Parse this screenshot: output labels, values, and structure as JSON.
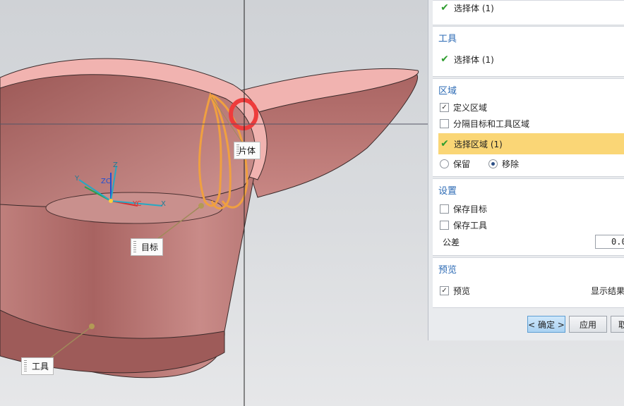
{
  "viewport": {
    "labels": {
      "sheet_body": "片体",
      "target": "目标",
      "tool": "工具"
    },
    "csys_axes": [
      "ZC",
      "YC",
      "X",
      "Y",
      "Z"
    ]
  },
  "panel": {
    "top_group": {
      "item": "选择体 (1)"
    },
    "tool_group": {
      "title": "工具",
      "item": "选择体 (1)"
    },
    "region_group": {
      "title": "区域",
      "define_region": {
        "label": "定义区域",
        "checked": true
      },
      "separate": {
        "label": "分隔目标和工具区域",
        "checked": false
      },
      "select_region": "选择区域 (1)",
      "keep": {
        "label": "保留",
        "selected": false
      },
      "remove": {
        "label": "移除",
        "selected": true
      }
    },
    "settings_group": {
      "title": "设置",
      "keep_target": {
        "label": "保存目标",
        "checked": false
      },
      "keep_tool": {
        "label": "保存工具",
        "checked": false
      },
      "tolerance_label": "公差",
      "tolerance_value": "0.0"
    },
    "preview_group": {
      "title": "预览",
      "preview": {
        "label": "预览",
        "checked": true
      },
      "show_result": "显示结果"
    },
    "buttons": {
      "ok": "< 确定 >",
      "apply": "应用",
      "cancel": "取"
    },
    "colors": {
      "highlight": "#fad676",
      "accent": "#2d6bb5",
      "check": "#2f9d2f"
    }
  }
}
